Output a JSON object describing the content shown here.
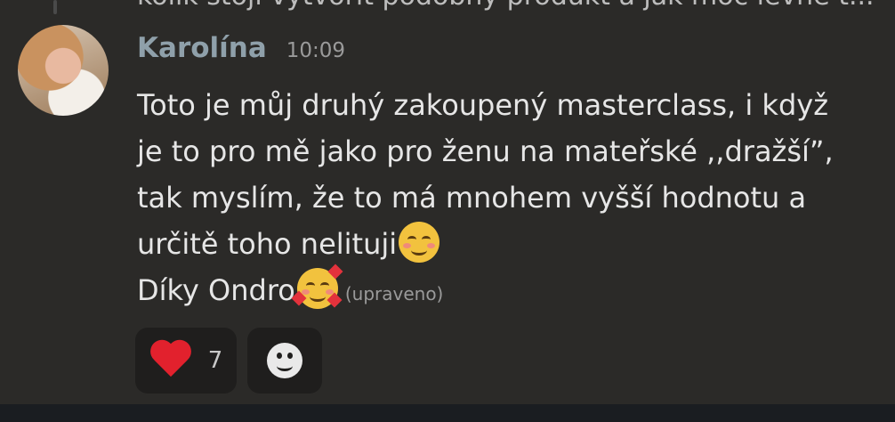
{
  "previous_message": {
    "text": "kolik stojí vytvořit podobný produkt a jak moc levně t..."
  },
  "message": {
    "author": "Karolína",
    "time": "10:09",
    "lines": [
      "Toto je můj druhý zakoupený masterclass, i když",
      "je to pro mě jako pro ženu na mateřské ,,dražší”,",
      "tak myslím, že to má mnohem vyšší hodnotu a",
      "určitě toho nelituji",
      "Díky Ondro"
    ],
    "emoji_line4": "smiling-face-with-blush-icon",
    "emoji_line5": "smiling-face-with-hearts-icon",
    "edited_label": "(upraveno)"
  },
  "reactions": [
    {
      "icon": "red-heart-icon",
      "count": "7"
    },
    {
      "icon": "add-reaction-icon"
    }
  ]
}
